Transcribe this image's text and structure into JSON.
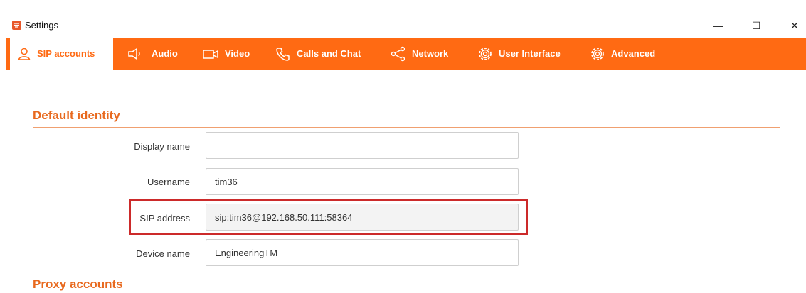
{
  "window": {
    "title": "Settings",
    "controls": {
      "minimize": "—",
      "maximize": "☐",
      "close": "✕"
    }
  },
  "tabs": [
    {
      "label": "SIP accounts",
      "icon": "user-icon",
      "active": true
    },
    {
      "label": "Audio",
      "icon": "speaker-icon",
      "active": false
    },
    {
      "label": "Video",
      "icon": "video-camera-icon",
      "active": false
    },
    {
      "label": "Calls and Chat",
      "icon": "phone-icon",
      "active": false
    },
    {
      "label": "Network",
      "icon": "share-icon",
      "active": false
    },
    {
      "label": "User Interface",
      "icon": "gear-icon",
      "active": false
    },
    {
      "label": "Advanced",
      "icon": "gear-icon",
      "active": false
    }
  ],
  "default_identity": {
    "heading": "Default identity",
    "display_name": {
      "label": "Display name",
      "value": ""
    },
    "username": {
      "label": "Username",
      "value": "tim36"
    },
    "sip_address": {
      "label": "SIP address",
      "value": "sip:tim36@192.168.50.111:58364"
    },
    "device_name": {
      "label": "Device name",
      "value": "EngineeringTM"
    }
  },
  "proxy_accounts": {
    "heading": "Proxy accounts"
  },
  "colors": {
    "accent": "#ff6a13",
    "heading": "#e8691e",
    "highlight": "#cc2a2a"
  }
}
